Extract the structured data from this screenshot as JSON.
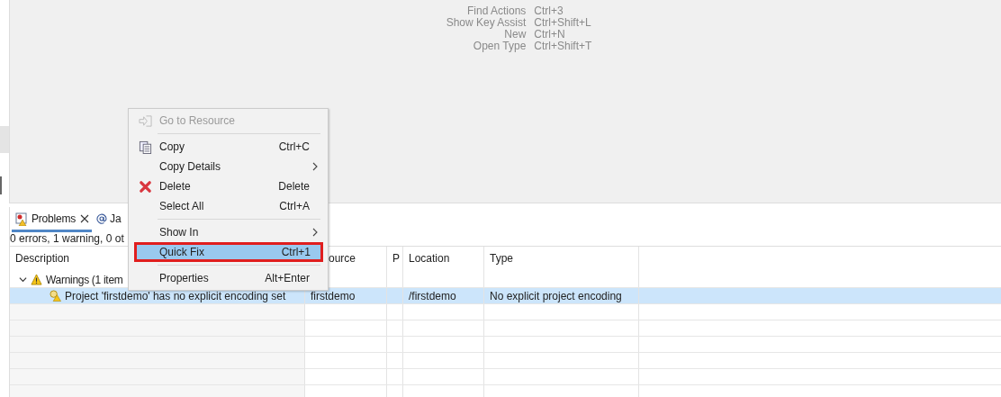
{
  "key_hints": [
    {
      "action": "Find Actions",
      "shortcut": "Ctrl+3"
    },
    {
      "action": "Show Key Assist",
      "shortcut": "Ctrl+Shift+L"
    },
    {
      "action": "New",
      "shortcut": "Ctrl+N"
    },
    {
      "action": "Open Type",
      "shortcut": "Ctrl+Shift+T"
    }
  ],
  "tabs": [
    {
      "label": "Problems",
      "closable": true,
      "selected": true
    },
    {
      "label": "Ja",
      "closable": false,
      "selected": false
    }
  ],
  "summary": "0 errors, 1 warning, 0 ot",
  "table": {
    "columns": [
      "Description",
      "ource",
      "P",
      "Location",
      "Type"
    ],
    "rows": [
      {
        "kind": "group",
        "expanded": true,
        "selected": false,
        "cells": [
          "Warnings (1 item",
          "",
          "",
          "",
          ""
        ]
      },
      {
        "kind": "item",
        "selected": true,
        "cells": [
          "Project 'firstdemo' has no explicit encoding set",
          "firstdemo",
          "",
          "/firstdemo",
          "No explicit project encoding"
        ]
      }
    ]
  },
  "context_menu": [
    {
      "kind": "item",
      "label": "Go to Resource",
      "disabled": true,
      "selected": false,
      "submenu": false
    },
    {
      "kind": "separator"
    },
    {
      "kind": "item",
      "label": "Copy",
      "shortcut": "Ctrl+C",
      "disabled": false,
      "selected": false,
      "submenu": false
    },
    {
      "kind": "item",
      "label": "Copy Details",
      "disabled": false,
      "selected": false,
      "submenu": true
    },
    {
      "kind": "item",
      "label": "Delete",
      "shortcut": "Delete",
      "disabled": false,
      "selected": false,
      "submenu": false
    },
    {
      "kind": "item",
      "label": "Select All",
      "shortcut": "Ctrl+A",
      "disabled": false,
      "selected": false,
      "submenu": false
    },
    {
      "kind": "separator"
    },
    {
      "kind": "item",
      "label": "Show In",
      "disabled": false,
      "selected": false,
      "submenu": true
    },
    {
      "kind": "item",
      "label": "Quick Fix",
      "shortcut": "Ctrl+1",
      "disabled": false,
      "selected": true,
      "submenu": false
    },
    {
      "kind": "separator"
    },
    {
      "kind": "item",
      "label": "Properties",
      "shortcut": "Alt+Enter",
      "disabled": false,
      "selected": false,
      "submenu": false
    }
  ]
}
